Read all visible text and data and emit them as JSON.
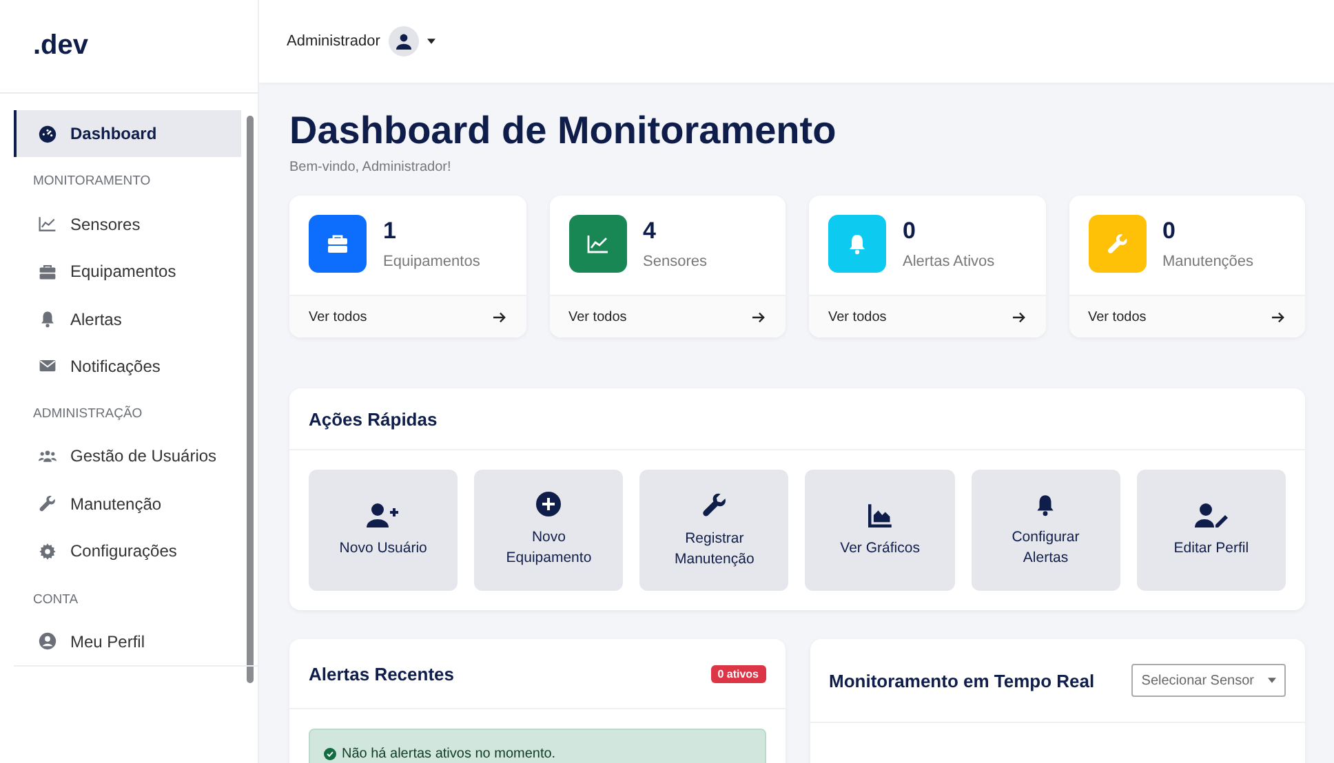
{
  "sidebar": {
    "logo": ".dev",
    "sections": [
      {
        "items": [
          {
            "label": "Dashboard",
            "selected": true
          }
        ]
      },
      {
        "title": "MONITORAMENTO",
        "items": [
          {
            "label": "Sensores",
            "selected": false
          },
          {
            "label": "Equipamentos",
            "selected": false
          },
          {
            "label": "Alertas",
            "selected": false
          },
          {
            "label": "Notificações",
            "selected": false
          }
        ]
      },
      {
        "title": "ADMINISTRAÇÃO",
        "items": [
          {
            "label": "Gestão de Usuários",
            "selected": false
          },
          {
            "label": "Manutenção",
            "selected": false
          },
          {
            "label": "Configurações",
            "selected": false
          }
        ]
      },
      {
        "title": "CONTA",
        "items": [
          {
            "label": "Meu Perfil",
            "selected": false
          }
        ]
      }
    ]
  },
  "topbar": {
    "user": "Administrador"
  },
  "page": {
    "title": "Dashboard de Monitoramento",
    "subtitle": "Bem-vindo, Administrador!"
  },
  "stats": [
    {
      "value": "1",
      "label": "Equipamentos",
      "color": "#0d6efd",
      "link": "Ver todos"
    },
    {
      "value": "4",
      "label": "Sensores",
      "color": "#198754",
      "link": "Ver todos"
    },
    {
      "value": "0",
      "label": "Alertas Ativos",
      "color": "#0dcaf0",
      "link": "Ver todos"
    },
    {
      "value": "0",
      "label": "Manutenções",
      "color": "#ffc107",
      "link": "Ver todos"
    }
  ],
  "quick_actions": {
    "title": "Ações Rápidas",
    "actions": [
      "Novo Usuário",
      "Novo Equipamento",
      "Registrar Manutenção",
      "Ver Gráficos",
      "Configurar Alertas",
      "Editar Perfil"
    ]
  },
  "recent_alerts": {
    "title": "Alertas Recentes",
    "badge": "0 ativos",
    "message": "Não há alertas ativos no momento."
  },
  "realtime": {
    "title": "Monitoramento em Tempo Real",
    "select": {
      "placeholder": "Selecionar Sensor"
    }
  }
}
